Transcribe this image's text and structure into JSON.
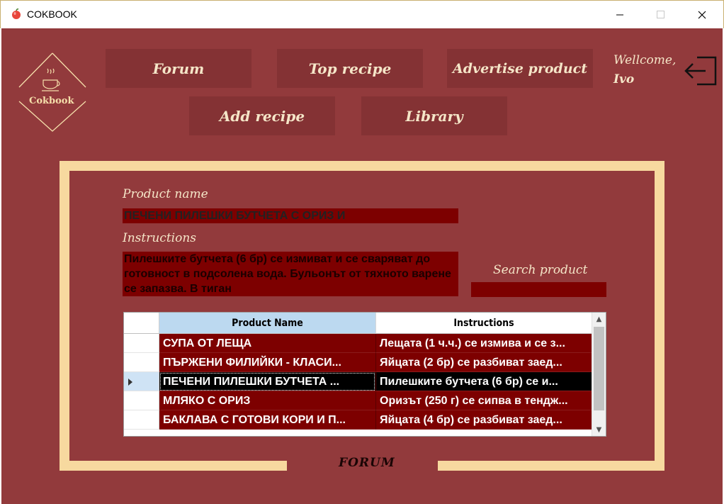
{
  "window": {
    "title": "COKBOOK",
    "app_icon": "apple-icon",
    "controls": [
      "minimize-icon",
      "maximize-icon",
      "close-icon"
    ]
  },
  "logo": {
    "text": "Cokbook",
    "icon": "coffee-cup-icon"
  },
  "nav": {
    "forum": "Forum",
    "top_recipe": "Top recipe",
    "advertise": "Advertise product",
    "add_recipe": "Add recipe",
    "library": "Library"
  },
  "user": {
    "welcome": "Wellcome,",
    "name": "Ivo",
    "logout_icon": "logout-icon"
  },
  "form": {
    "product_name_label": "Product name",
    "product_name_value": "ПЕЧЕНИ ПИЛЕШКИ БУТЧЕТА С ОРИЗ И",
    "instructions_label": "Instructions",
    "instructions_value": "Пилешките бутчета (6 бр) се измиват и се сваряват до готовност в подсолена вода. Бульонът от тяхното варене се запазва. В тиган",
    "search_label": "Search product",
    "search_value": ""
  },
  "grid": {
    "columns": [
      "Product Name",
      "Instructions"
    ],
    "rows": [
      {
        "name": "СУПА ОТ ЛЕЩА",
        "instructions": "Лещата (1 ч.ч.) се измива и се з...",
        "selected": false
      },
      {
        "name": "ПЪРЖЕНИ ФИЛИЙКИ - КЛАСИ...",
        "instructions": "Яйцата (2 бр) се разбиват заед...",
        "selected": false
      },
      {
        "name": "ПЕЧЕНИ ПИЛЕШКИ БУТЧЕТА ...",
        "instructions": "Пилешките бутчета (6 бр) се и...",
        "selected": true
      },
      {
        "name": "МЛЯКО С ОРИЗ",
        "instructions": "Оризът (250 г) се сипва в тендж...",
        "selected": false
      },
      {
        "name": "БАКЛАВА С ГОТОВИ КОРИ И П...",
        "instructions": "Яйцата (4 бр) се разбиват заед...",
        "selected": false
      }
    ]
  },
  "footer": {
    "section_label": "FORUM"
  },
  "colors": {
    "background": "#923a3c",
    "nav_button": "#843234",
    "frame": "#f7d99f",
    "field": "#7d0000",
    "header_selected": "#bcd9f0",
    "row_selected": "#000000"
  }
}
